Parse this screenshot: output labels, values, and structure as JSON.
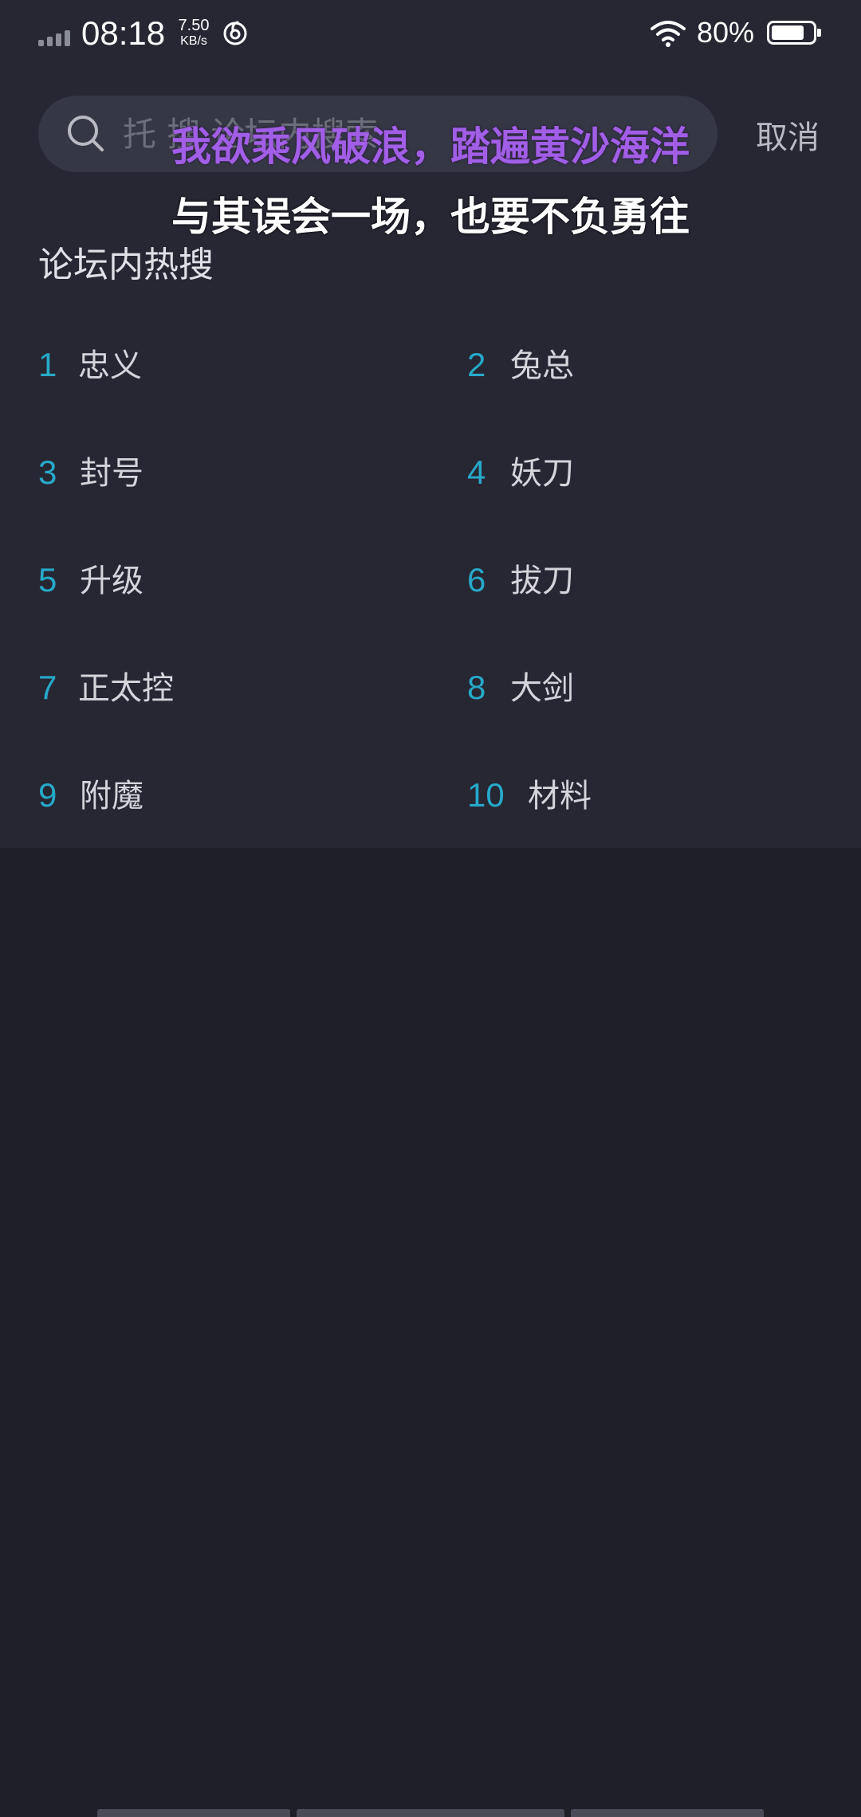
{
  "status_bar": {
    "time": "08:18",
    "net_speed_value": "7.50",
    "net_speed_unit": "KB/s",
    "battery_percent": "80%",
    "battery_level": 0.8,
    "icons": [
      "signal-icon",
      "netease-music-icon",
      "wifi-icon",
      "battery-icon"
    ]
  },
  "search": {
    "placeholder": "托 搜 论坛内搜索",
    "value": "",
    "cancel_label": "取消"
  },
  "lyrics": {
    "line1": "我欲乘风破浪，踏遍黄沙海洋",
    "line2": "与其误会一场，也要不负勇往",
    "line1_color": "#a15ee6",
    "line2_color": "#ffffff"
  },
  "hot_search": {
    "title": "论坛内热搜",
    "rank_color": "#27a9c9",
    "items": [
      {
        "rank": "1",
        "text": "忠义"
      },
      {
        "rank": "2",
        "text": "兔总"
      },
      {
        "rank": "3",
        "text": "封号"
      },
      {
        "rank": "4",
        "text": "妖刀"
      },
      {
        "rank": "5",
        "text": "升级"
      },
      {
        "rank": "6",
        "text": "拔刀"
      },
      {
        "rank": "7",
        "text": "正太控"
      },
      {
        "rank": "8",
        "text": "大剑"
      },
      {
        "rank": "9",
        "text": "附魔"
      },
      {
        "rank": "10",
        "text": "材料"
      }
    ]
  }
}
